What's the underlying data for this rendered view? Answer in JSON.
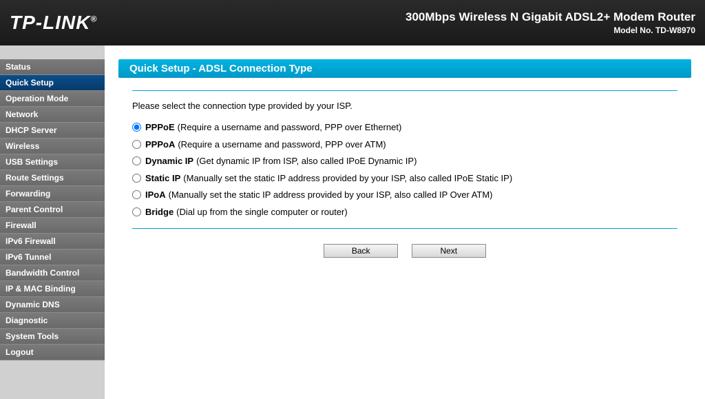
{
  "header": {
    "brand": "TP-LINK",
    "reg": "®",
    "title": "300Mbps Wireless N Gigabit ADSL2+ Modem Router",
    "model": "Model No. TD-W8970"
  },
  "sidebar": {
    "items": [
      {
        "label": "Status"
      },
      {
        "label": "Quick Setup"
      },
      {
        "label": "Operation Mode"
      },
      {
        "label": "Network"
      },
      {
        "label": "DHCP Server"
      },
      {
        "label": "Wireless"
      },
      {
        "label": "USB Settings"
      },
      {
        "label": "Route Settings"
      },
      {
        "label": "Forwarding"
      },
      {
        "label": "Parent Control"
      },
      {
        "label": "Firewall"
      },
      {
        "label": "IPv6 Firewall"
      },
      {
        "label": "IPv6 Tunnel"
      },
      {
        "label": "Bandwidth Control"
      },
      {
        "label": "IP & MAC Binding"
      },
      {
        "label": "Dynamic DNS"
      },
      {
        "label": "Diagnostic"
      },
      {
        "label": "System Tools"
      },
      {
        "label": "Logout"
      }
    ],
    "active_index": 1
  },
  "page": {
    "title": "Quick Setup - ADSL Connection Type",
    "instruction": "Please select the connection type provided by your ISP.",
    "options": [
      {
        "label": "PPPoE",
        "desc": "(Require a username and password, PPP over Ethernet)"
      },
      {
        "label": "PPPoA",
        "desc": "(Require a username and password, PPP over ATM)"
      },
      {
        "label": "Dynamic IP",
        "desc": "(Get dynamic IP from ISP, also called IPoE Dynamic IP)"
      },
      {
        "label": "Static IP",
        "desc": "(Manually set the static IP address provided by your ISP, also called IPoE Static IP)"
      },
      {
        "label": "IPoA",
        "desc": "(Manually set the static IP address provided by your ISP, also called IP Over ATM)"
      },
      {
        "label": "Bridge",
        "desc": "(Dial up from the single computer or router)"
      }
    ],
    "selected_index": 0,
    "buttons": {
      "back": "Back",
      "next": "Next"
    }
  }
}
